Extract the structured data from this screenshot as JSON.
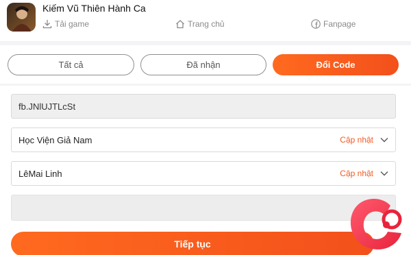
{
  "header": {
    "title": "Kiếm Vũ Thiên Hành Ca",
    "nav": {
      "download_label": "Tải game",
      "home_label": "Trang chủ",
      "fanpage_label": "Fanpage"
    }
  },
  "tabs": [
    {
      "label": "Tất cả",
      "active": false
    },
    {
      "label": "Đã nhận",
      "active": false
    },
    {
      "label": "Đổi Code",
      "active": true
    }
  ],
  "form": {
    "code_value": "fb.JNlUJTLcSt",
    "server": {
      "value": "Học Viện Giả Nam",
      "action": "Cập nhật"
    },
    "character": {
      "value": "LêMai Linh",
      "action": "Cập nhật"
    },
    "extra": {
      "value": ""
    }
  },
  "continue_label": "Tiếp tục",
  "colors": {
    "accent": "#f15a22",
    "accent_gradient_start": "#ff6a1f",
    "accent_gradient_end": "#f3501b"
  },
  "icons": [
    "game-app-icon",
    "download-icon",
    "home-icon",
    "facebook-icon",
    "chevron-down-icon",
    "watermark-logo"
  ]
}
